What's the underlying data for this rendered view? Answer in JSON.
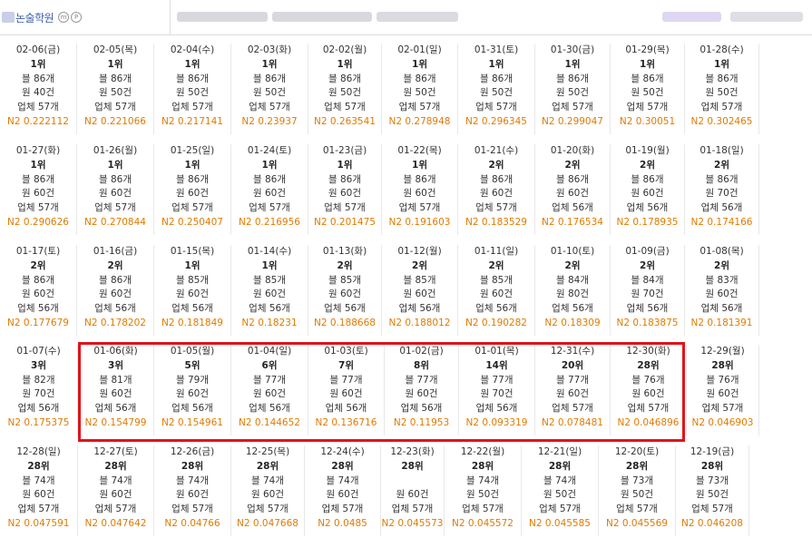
{
  "header": {
    "brand_name": "논술학원",
    "badge_m": "m",
    "badge_p": "P"
  },
  "rows": [
    [
      {
        "date": "02-06(금)",
        "rank": "1위",
        "blog": "블 86개",
        "won": "원 40건",
        "biz": "업체 57개",
        "n2": "N2 0.222112"
      },
      {
        "date": "02-05(목)",
        "rank": "1위",
        "blog": "블 86개",
        "won": "원 50건",
        "biz": "업체 57개",
        "n2": "N2 0.221066"
      },
      {
        "date": "02-04(수)",
        "rank": "1위",
        "blog": "블 86개",
        "won": "원 50건",
        "biz": "업체 57개",
        "n2": "N2 0.217141"
      },
      {
        "date": "02-03(화)",
        "rank": "1위",
        "blog": "블 86개",
        "won": "원 50건",
        "biz": "업체 57개",
        "n2": "N2 0.23937"
      },
      {
        "date": "02-02(월)",
        "rank": "1위",
        "blog": "블 86개",
        "won": "원 50건",
        "biz": "업체 57개",
        "n2": "N2 0.263541"
      },
      {
        "date": "02-01(일)",
        "rank": "1위",
        "blog": "블 86개",
        "won": "원 50건",
        "biz": "업체 57개",
        "n2": "N2 0.278948"
      },
      {
        "date": "01-31(토)",
        "rank": "1위",
        "blog": "블 86개",
        "won": "원 50건",
        "biz": "업체 57개",
        "n2": "N2 0.296345"
      },
      {
        "date": "01-30(금)",
        "rank": "1위",
        "blog": "블 86개",
        "won": "원 50건",
        "biz": "업체 57개",
        "n2": "N2 0.299047"
      },
      {
        "date": "01-29(목)",
        "rank": "1위",
        "blog": "블 86개",
        "won": "원 50건",
        "biz": "업체 57개",
        "n2": "N2 0.30051"
      },
      {
        "date": "01-28(수)",
        "rank": "1위",
        "blog": "블 86개",
        "won": "원 50건",
        "biz": "업체 57개",
        "n2": "N2 0.302465"
      }
    ],
    [
      {
        "date": "01-27(화)",
        "rank": "1위",
        "blog": "블 86개",
        "won": "원 60건",
        "biz": "업체 57개",
        "n2": "N2 0.290626"
      },
      {
        "date": "01-26(월)",
        "rank": "1위",
        "blog": "블 86개",
        "won": "원 60건",
        "biz": "업체 57개",
        "n2": "N2 0.270844"
      },
      {
        "date": "01-25(일)",
        "rank": "1위",
        "blog": "블 86개",
        "won": "원 60건",
        "biz": "업체 57개",
        "n2": "N2 0.250407"
      },
      {
        "date": "01-24(토)",
        "rank": "1위",
        "blog": "블 86개",
        "won": "원 60건",
        "biz": "업체 57개",
        "n2": "N2 0.216956"
      },
      {
        "date": "01-23(금)",
        "rank": "1위",
        "blog": "블 86개",
        "won": "원 60건",
        "biz": "업체 57개",
        "n2": "N2 0.201475"
      },
      {
        "date": "01-22(목)",
        "rank": "1위",
        "blog": "블 86개",
        "won": "원 60건",
        "biz": "업체 57개",
        "n2": "N2 0.191603"
      },
      {
        "date": "01-21(수)",
        "rank": "2위",
        "blog": "블 86개",
        "won": "원 60건",
        "biz": "업체 57개",
        "n2": "N2 0.183529"
      },
      {
        "date": "01-20(화)",
        "rank": "2위",
        "blog": "블 86개",
        "won": "원 60건",
        "biz": "업체 56개",
        "n2": "N2 0.176534"
      },
      {
        "date": "01-19(월)",
        "rank": "2위",
        "blog": "블 86개",
        "won": "원 60건",
        "biz": "업체 56개",
        "n2": "N2 0.178935"
      },
      {
        "date": "01-18(일)",
        "rank": "2위",
        "blog": "블 86개",
        "won": "원 70건",
        "biz": "업체 56개",
        "n2": "N2 0.174166"
      }
    ],
    [
      {
        "date": "01-17(토)",
        "rank": "2위",
        "blog": "블 86개",
        "won": "원 60건",
        "biz": "업체 56개",
        "n2": "N2 0.177679"
      },
      {
        "date": "01-16(금)",
        "rank": "2위",
        "blog": "블 86개",
        "won": "원 60건",
        "biz": "업체 56개",
        "n2": "N2 0.178202"
      },
      {
        "date": "01-15(목)",
        "rank": "1위",
        "blog": "블 85개",
        "won": "원 60건",
        "biz": "업체 56개",
        "n2": "N2 0.181849"
      },
      {
        "date": "01-14(수)",
        "rank": "1위",
        "blog": "블 85개",
        "won": "원 60건",
        "biz": "업체 56개",
        "n2": "N2 0.18231"
      },
      {
        "date": "01-13(화)",
        "rank": "2위",
        "blog": "블 85개",
        "won": "원 60건",
        "biz": "업체 56개",
        "n2": "N2 0.188668"
      },
      {
        "date": "01-12(월)",
        "rank": "2위",
        "blog": "블 85개",
        "won": "원 60건",
        "biz": "업체 56개",
        "n2": "N2 0.188012"
      },
      {
        "date": "01-11(일)",
        "rank": "2위",
        "blog": "블 85개",
        "won": "원 60건",
        "biz": "업체 56개",
        "n2": "N2 0.190282"
      },
      {
        "date": "01-10(토)",
        "rank": "2위",
        "blog": "블 84개",
        "won": "원 80건",
        "biz": "업체 56개",
        "n2": "N2 0.18309"
      },
      {
        "date": "01-09(금)",
        "rank": "2위",
        "blog": "블 84개",
        "won": "원 70건",
        "biz": "업체 56개",
        "n2": "N2 0.183875"
      },
      {
        "date": "01-08(목)",
        "rank": "2위",
        "blog": "블 83개",
        "won": "원 60건",
        "biz": "업체 56개",
        "n2": "N2 0.181391"
      }
    ],
    [
      {
        "date": "01-07(수)",
        "rank": "3위",
        "blog": "블 82개",
        "won": "원 70건",
        "biz": "업체 56개",
        "n2": "N2 0.175375"
      },
      {
        "date": "01-06(화)",
        "rank": "3위",
        "blog": "블 81개",
        "won": "원 60건",
        "biz": "업체 56개",
        "n2": "N2 0.154799"
      },
      {
        "date": "01-05(월)",
        "rank": "5위",
        "blog": "블 79개",
        "won": "원 60건",
        "biz": "업체 56개",
        "n2": "N2 0.154961"
      },
      {
        "date": "01-04(일)",
        "rank": "6위",
        "blog": "블 77개",
        "won": "원 60건",
        "biz": "업체 56개",
        "n2": "N2 0.144652"
      },
      {
        "date": "01-03(토)",
        "rank": "7위",
        "blog": "블 77개",
        "won": "원 60건",
        "biz": "업체 56개",
        "n2": "N2 0.136716"
      },
      {
        "date": "01-02(금)",
        "rank": "8위",
        "blog": "블 77개",
        "won": "원 60건",
        "biz": "업체 56개",
        "n2": "N2 0.11953"
      },
      {
        "date": "01-01(목)",
        "rank": "14위",
        "blog": "블 77개",
        "won": "원 70건",
        "biz": "업체 56개",
        "n2": "N2 0.093319"
      },
      {
        "date": "12-31(수)",
        "rank": "20위",
        "blog": "블 77개",
        "won": "원 60건",
        "biz": "업체 57개",
        "n2": "N2 0.078481"
      },
      {
        "date": "12-30(화)",
        "rank": "28위",
        "blog": "블 76개",
        "won": "원 60건",
        "biz": "업체 57개",
        "n2": "N2 0.046896"
      },
      {
        "date": "12-29(월)",
        "rank": "28위",
        "blog": "블 76개",
        "won": "원 60건",
        "biz": "업체 57개",
        "n2": "N2 0.046903"
      }
    ],
    [
      {
        "date": "12-28(일)",
        "rank": "28위",
        "blog": "블 74개",
        "won": "원 60건",
        "biz": "업체 57개",
        "n2": "N2 0.047591"
      },
      {
        "date": "12-27(토)",
        "rank": "28위",
        "blog": "블 74개",
        "won": "원 60건",
        "biz": "업체 57개",
        "n2": "N2 0.047642"
      },
      {
        "date": "12-26(금)",
        "rank": "28위",
        "blog": "블 74개",
        "won": "원 60건",
        "biz": "업체 57개",
        "n2": "N2 0.04766"
      },
      {
        "date": "12-25(목)",
        "rank": "28위",
        "blog": "블 74개",
        "won": "원 60건",
        "biz": "업체 57개",
        "n2": "N2 0.047668"
      },
      {
        "date": "12-24(수)",
        "rank": "28위",
        "blog": "블 74개",
        "won": "원 60건",
        "biz": "업체 57개",
        "n2": "N2 0.0485"
      },
      {
        "date": "12-23(화)",
        "rank": "28위",
        "blog": "",
        "won": "원 60건",
        "biz": "업체 57개",
        "n2": "N2 0.045573"
      },
      {
        "date": "12-22(월)",
        "rank": "28위",
        "blog": "블 74개",
        "won": "원 50건",
        "biz": "업체 57개",
        "n2": "N2 0.045572"
      },
      {
        "date": "12-21(일)",
        "rank": "28위",
        "blog": "블 74개",
        "won": "원 50건",
        "biz": "업체 57개",
        "n2": "N2 0.045585"
      },
      {
        "date": "12-20(토)",
        "rank": "28위",
        "blog": "블 73개",
        "won": "원 50건",
        "biz": "업체 57개",
        "n2": "N2 0.045569"
      },
      {
        "date": "12-19(금)",
        "rank": "28위",
        "blog": "블 73개",
        "won": "원 50건",
        "biz": "업체 57개",
        "n2": "N2 0.046208"
      }
    ]
  ],
  "colors": {
    "n2_text": "#e07b00",
    "highlight_border": "#e0141a",
    "brand_text": "#3b5ea8"
  }
}
